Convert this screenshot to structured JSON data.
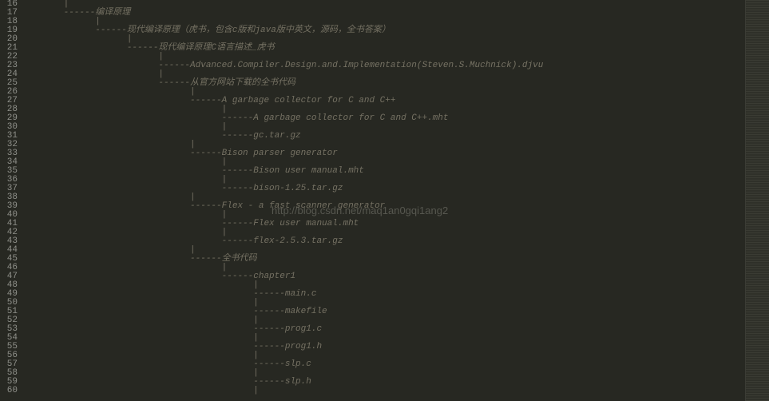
{
  "watermark": "http://blog.csdn.net/maq1an0gqi1ang2",
  "startLineNumber": 16,
  "lines": [
    "      |",
    "      ------编译原理",
    "            |",
    "            ------现代编译原理（虎书，包含c版和java版中英文，源码，全书答案）",
    "                  |",
    "                  ------现代编译原理C语言描述_虎书",
    "                        |",
    "                        ------Advanced.Compiler.Design.and.Implementation(Steven.S.Muchnick).djvu",
    "                        |",
    "                        ------从官方网站下载的全书代码",
    "                              |",
    "                              ------A garbage collector for C and C++",
    "                                    |",
    "                                    ------A garbage collector for C and C++.mht",
    "                                    |",
    "                                    ------gc.tar.gz",
    "                              |",
    "                              ------Bison parser generator",
    "                                    |",
    "                                    ------Bison user manual.mht",
    "                                    |",
    "                                    ------bison-1.25.tar.gz",
    "                              |",
    "                              ------Flex - a fast scanner generator",
    "                                    |",
    "                                    ------Flex user manual.mht",
    "                                    |",
    "                                    ------flex-2.5.3.tar.gz",
    "                              |",
    "                              ------全书代码",
    "                                    |",
    "                                    ------chapter1",
    "                                          |",
    "                                          ------main.c",
    "                                          |",
    "                                          ------makefile",
    "                                          |",
    "                                          ------prog1.c",
    "                                          |",
    "                                          ------prog1.h",
    "                                          |",
    "                                          ------slp.c",
    "                                          |",
    "                                          ------slp.h",
    "                                          |"
  ]
}
